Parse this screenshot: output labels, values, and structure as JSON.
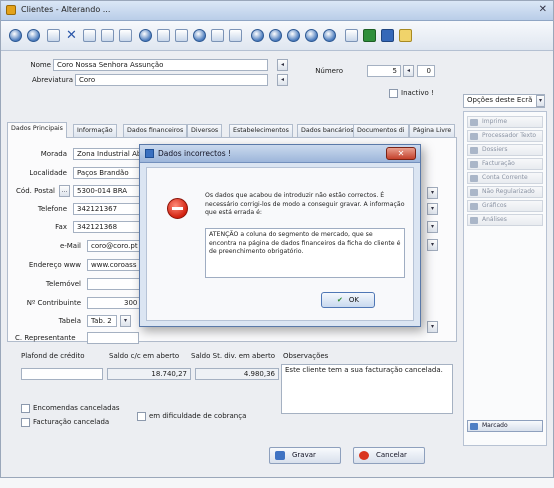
{
  "window": {
    "title": "Clientes - Alterando ..."
  },
  "form": {
    "nome_label": "Nome",
    "nome_value": "Coro Nossa Senhora Assunção",
    "abreviatura_label": "Abreviatura",
    "abreviatura_value": "Coro",
    "numero_label": "Número",
    "numero_value": "5",
    "numero_extra": "0",
    "inactivo_label": "Inactivo !"
  },
  "options": {
    "select_label": "Opções deste Ecrã",
    "items": [
      "Imprime",
      "Processador Texto",
      "Dossiers",
      "Facturação",
      "Conta Corrente",
      "Não Regularizado",
      "Gráficos",
      "Análises"
    ],
    "marcado_label": "Marcado"
  },
  "tabs": [
    "Dados Principais",
    "Informação",
    "Dados financeiros",
    "Diversos",
    "Estabelecimentos",
    "Dados bancários",
    "Documentos di",
    "Página Livre"
  ],
  "fields": {
    "morada_label": "Morada",
    "morada_value": "Zona Industrial Abelheira",
    "localidade_label": "Localidade",
    "localidade_value": "Paços Brandão",
    "codpostal_label": "Cód. Postal",
    "codpostal_value": "5300-014 BRA",
    "telefone_label": "Telefone",
    "telefone_value": "342121367",
    "fax_label": "Fax",
    "fax_value": "342121368",
    "email_label": "e-Mail",
    "email_value": "coro@coro.pt",
    "endereco_label": "Endereço www",
    "endereco_value": "www.coroass",
    "telemovel_label": "Telemóvel",
    "contribuinte_label": "Nº Contribuinte",
    "contribuinte_value": "300",
    "tabela_label": "Tabela",
    "tabela_value": "Tab. 2",
    "representante_label": "C. Representante"
  },
  "financial": {
    "plafond_label": "Plafond de crédito",
    "saldo_cc_label": "Saldo c/c em aberto",
    "saldo_cc_value": "18.740,27",
    "saldo_st_label": "Saldo St. div. em aberto",
    "saldo_st_value": "4.980,36",
    "obs_label": "Observações",
    "obs_value": "Este cliente tem a sua facturação cancelada."
  },
  "checkboxes": {
    "encomendas": "Encomendas canceladas",
    "facturacao": "Facturação cancelada",
    "dificuldade": "em dificuldade de cobrança"
  },
  "dialog": {
    "title": "Dados incorrectos !",
    "message": "Os dados que acabou de introduzir não estão correctos. É necessário corrigi-los de modo a conseguir gravar. A informação que está errada é:",
    "detail": "ATENÇÃO a coluna do segmento de mercado, que se encontra na página de dados financeiros da ficha do cliente é de preenchimento obrigatório.",
    "ok_label": "OK"
  },
  "actions": {
    "gravar": "Gravar",
    "cancelar": "Cancelar"
  },
  "colors": {
    "accent": "#3568b8",
    "error": "#d2210f"
  }
}
